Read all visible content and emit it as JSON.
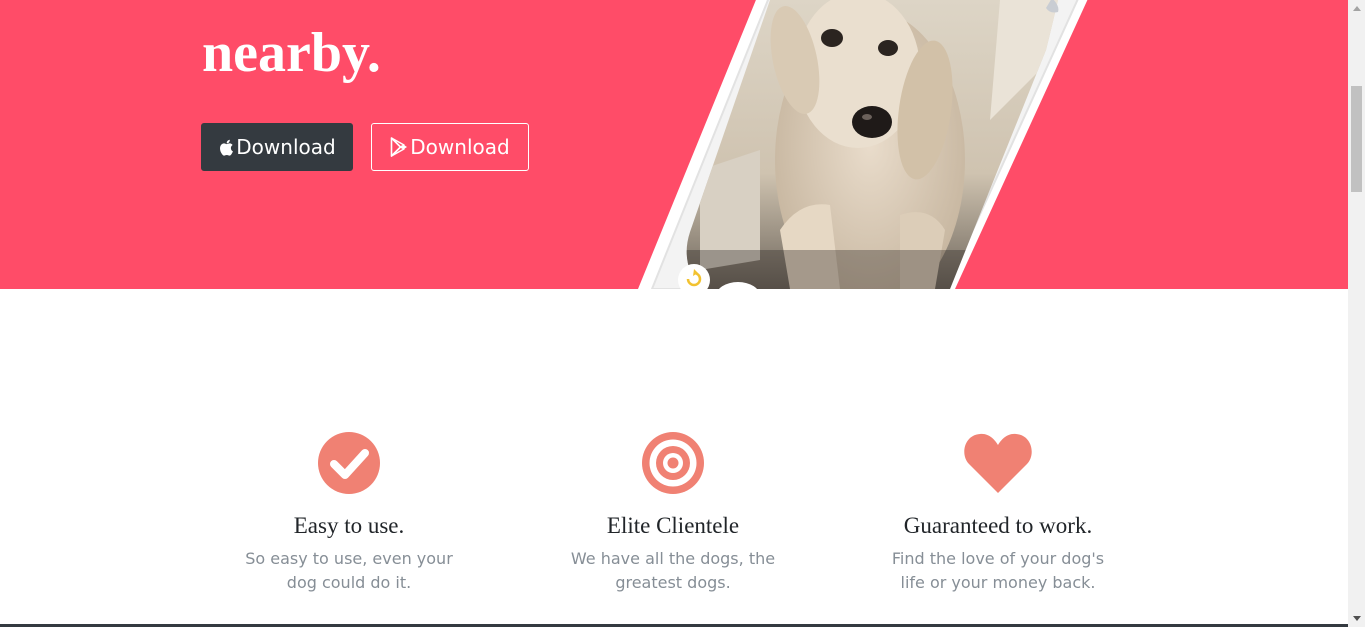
{
  "hero": {
    "headline": "nearby.",
    "apple_button_label": "Download",
    "play_button_label": "Download",
    "background_color": "#ff4c68"
  },
  "features": [
    {
      "icon": "check-circle-icon",
      "title": "Easy to use.",
      "text": "So easy to use, even your dog could do it."
    },
    {
      "icon": "target-icon",
      "title": "Elite Clientele",
      "text": "We have all the dogs, the greatest dogs."
    },
    {
      "icon": "heart-icon",
      "title": "Guaranteed to work.",
      "text": "Find the love of your dog's life or your money back."
    }
  ],
  "colors": {
    "accent": "#f08173",
    "dark": "#343a40"
  }
}
